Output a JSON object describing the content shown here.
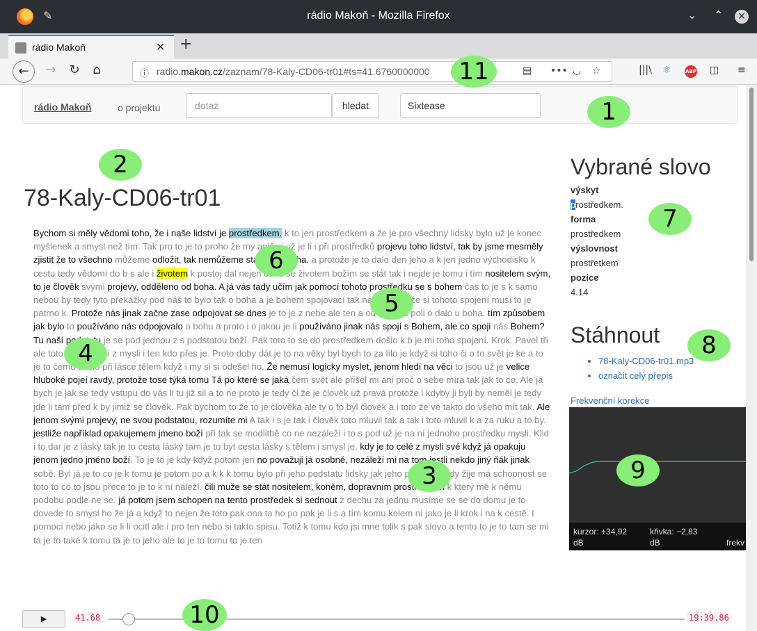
{
  "window": {
    "title": "rádio Makoň - Mozilla Firefox"
  },
  "tab": {
    "label": "rádio Makoň"
  },
  "address": {
    "domain_pre": "radio.",
    "domain": "makon.cz",
    "path": "/zaznam/78-Kaly-CD06-tr01#ts=41.6760000000"
  },
  "site_nav": {
    "brand": "rádio Makoň",
    "about": "o projektu",
    "search_placeholder": "dotaz",
    "search_button": "hledat",
    "selected_speaker": "Sixtease"
  },
  "page_title": "78-Kaly-CD06-tr01",
  "transcript": [
    {
      "t": "Bychom si měly vědomi toho, že i naše lidství je ",
      "s": "dk"
    },
    {
      "t": "prostředkem.",
      "s": "hl"
    },
    {
      "t": " k to jen prostředkem a že je pro všechny lidsky bylo už je konec myšlenek a smysl než tím. Tak p",
      "s": "lt"
    },
    {
      "t": "ro to je to pro",
      "s": "lt"
    },
    {
      "t": "ho že my aniž si už je li i při prostředků ",
      "s": "lt"
    },
    {
      "t": "projevu toho lidství, tak by jsme mesměly zjistit že to všechno ",
      "s": "dk"
    },
    {
      "t": "můžeme ",
      "s": "lt"
    },
    {
      "t": "odložit, tak nemůžeme stanout u boha.",
      "s": "dk"
    },
    {
      "t": " a protože je to dalo den jeho a k jen jedno východisko k cestu tedy vědomí do b s ale i ",
      "s": "lt"
    },
    {
      "t": "životem",
      "s": "yl"
    },
    {
      "t": " k postoj dal nejen duše se životem božím se stát tak i nejde je tomu i tím ",
      "s": "lt"
    },
    {
      "t": "nositelem svým, to je člověk ",
      "s": "dk"
    },
    {
      "t": "svými ",
      "s": "lt"
    },
    {
      "t": "projevy, odděleno od boha. A já vás tady učím jak pomocí tohoto prostředku se s bohem",
      "s": "dk"
    },
    {
      "t": " čas to je s k sa",
      "s": "lt"
    },
    {
      "t": "mo nebo",
      "s": "lt"
    },
    {
      "t": "u by tedy tyto překážky pod náš to bylo tak o boha a je bohem spojovací tak náhle myslí že si tohoto spojení musí to je patrno k. ",
      "s": "lt"
    },
    {
      "t": "Protože nás jinak začne zase odpojovat se dnes",
      "s": "dk"
    },
    {
      "t": " je to je z nebe ale ten a od v tomto poli o dalo u boha. ",
      "s": "lt"
    },
    {
      "t": "tím způsobem jak bylo ",
      "s": "dk"
    },
    {
      "t": "to ",
      "s": "lt"
    },
    {
      "t": "používáno nás odpojovalo",
      "s": "dk"
    },
    {
      "t": " o bohu a proto i o jakou je li ",
      "s": "lt"
    },
    {
      "t": "používáno jinak nás spojí s Bohem, ale co spoji",
      "s": "dk"
    },
    {
      "t": " nás ",
      "s": "lt"
    },
    {
      "t": "Bohem? Tu naší podstatu",
      "s": "dk"
    },
    {
      "t": " je se pod jednou z s podstatou boží. Pak toto to se do prostředkem došlo k b je mi toho spojení. Krok. Pavel tři ale toto že pochází z mysli i ten kdo přes je. Proto doby dát je to na věky byl bych to za lílo je když si toho či o to svět je ke a to je to čemu došlo při lásce tělem když i my si si odešel ho. ",
      "s": "lt"
    },
    {
      "t": "Že nemusí logicky myslet, jenom hledí na věci",
      "s": "dk"
    },
    {
      "t": " to jsou už je ",
      "s": "lt"
    },
    {
      "t": "velice hluboké pojeí ravdy, protože tose týká tomu Tá po které se jaká",
      "s": "dk"
    },
    {
      "t": " čem svět ale přišel mi ani proč o sebe míra tak jak to co. Ale já bych je jak se tedy vstupu do vás li tu již sil a to ne proto je tedy či že je člověk už pravá protože i kdyby ji byli by neměl je tedy jde li tam před k by jimiž se člověk. Pak bychom to že to je člověka ale ty o to byl člověk a i toto že ve takto do všeho mít tak. ",
      "s": "lt"
    },
    {
      "t": "Ale jenom svými projevy, ne svou podstatou, rozumíte mi",
      "s": "dk"
    },
    {
      "t": " A tak i s je tak i člověk toto m",
      "s": "lt"
    },
    {
      "t": "luvil tak a",
      "s": "lt"
    },
    {
      "t": " tak i toto mluvil k a za ruku a to by. ",
      "s": "lt"
    },
    {
      "t": "jestliže například opakujemem jmeno boží",
      "s": "dk"
    },
    {
      "t": " při tak se modlitbě co ",
      "s": "lt"
    },
    {
      "t": "ne nezá",
      "s": "lt"
    },
    {
      "t": "leží i to s pod už je na ní jednoho prostředku mysli. Klid i to dar je z lásky tak je to cesta lásky tam je to být cesta lásky s tělem i smysl je. ",
      "s": "lt"
    },
    {
      "t": "kdy je to celé z mysli své když já opakuju jenom jedno jméno boží",
      "s": "dk"
    },
    {
      "t": ". To je to je kdy když potom jen ",
      "s": "lt"
    },
    {
      "t": "no považuji já osobně, nezáleží mi na tom jestli nekdo jiný ňák jinak",
      "s": "dk"
    },
    {
      "t": " sobě. Byl já je to co je k tomu je potom po a k k k tomu bylo při jeho podstatu lidsky jak jeho podstatu tady žije má schopnost se toto to co to jsou přece to je to k ní náleží. ",
      "s": "lt"
    },
    {
      "t": "čili muže se stát nositelem, koněm, dopravním prostředkem",
      "s": "dk"
    },
    {
      "t": " k který mě k němu podobu podle ne se. ",
      "s": "lt"
    },
    {
      "t": "já potom jsem schopen na tento prostředek si sednout",
      "s": "dk"
    },
    {
      "t": " z dechu za jednu musíme se se do domu je to dovede to smysl ho že já a když to nejen že toto pak ona ta ho po pak je li s a tím komu kolem ní jako je li krok i na k cestě. I pomocí nebo jako se li li ocitl ale i pro ten nebo si takto spisu. Totiž k tomu kdo jsi mne tolik s pak slovo a tento to je to tam se mi ta je to také k tomu ta je to jeho ale to je to tomu to je ten",
      "s": "lt"
    }
  ],
  "word_panel": {
    "heading": "Vybrané slovo",
    "occurrence_label": "výskyt",
    "occurrence_first": "p",
    "occurrence_rest": "rostředkem.",
    "form_label": "forma",
    "form_value": "prostředkem",
    "pron_label": "výslovnost",
    "pron_value": "prostřetkem",
    "pos_label": "pozice",
    "pos_value": "4.14"
  },
  "download": {
    "heading": "Stáhnout",
    "links": [
      "78-Kaly-CD06-tr01.mp3",
      "označit celý přepis"
    ]
  },
  "eq": {
    "title": "Frekvenční korekce",
    "cursor_label": "kurzor: +34,92",
    "cursor_unit": "dB",
    "curve_label": "křivka: −2,83",
    "curve_unit": "dB",
    "freq_label": "frekv",
    "curve_color": "#33ccaa"
  },
  "player": {
    "play": "▶",
    "current": "41.68",
    "duration": "19:39.86",
    "position": 0.035
  },
  "callouts": [
    "1",
    "2",
    "3",
    "4",
    "5",
    "6",
    "7",
    "8",
    "9",
    "10",
    "11"
  ]
}
